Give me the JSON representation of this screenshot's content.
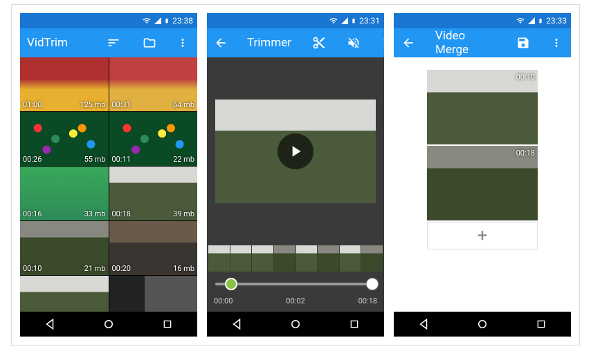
{
  "screen1": {
    "status_time": "23:38",
    "appbar_title": "VidTrim",
    "thumbs": [
      {
        "dur": "01:00",
        "size": "125 mb",
        "cls": "t-play1"
      },
      {
        "dur": "00:31",
        "size": "64 mb",
        "cls": "t-play2"
      },
      {
        "dur": "00:26",
        "size": "55 mb",
        "cls": "t-balls1"
      },
      {
        "dur": "00:11",
        "size": "22 mb",
        "cls": "t-balls1"
      },
      {
        "dur": "00:16",
        "size": "33 mb",
        "cls": "t-green1"
      },
      {
        "dur": "00:18",
        "size": "39 mb",
        "cls": "t-forest"
      },
      {
        "dur": "00:10",
        "size": "21 mb",
        "cls": "t-forestdark"
      },
      {
        "dur": "00:20",
        "size": "16 mb",
        "cls": "t-indoor"
      },
      {
        "dur": "",
        "size": "",
        "cls": "t-forest"
      },
      {
        "dur": "",
        "size": "",
        "cls": "t-portrait"
      }
    ]
  },
  "screen2": {
    "status_time": "23:31",
    "appbar_title": "Trimmer",
    "time_start": "00:00",
    "time_cur": "00:02",
    "time_end": "00:18"
  },
  "screen3": {
    "status_time": "23:33",
    "appbar_title": "Video Merge",
    "clips": [
      {
        "time": "00:10",
        "cls": "t-forest"
      },
      {
        "time": "00:18",
        "cls": "t-forestdark"
      }
    ],
    "add_label": "+"
  }
}
